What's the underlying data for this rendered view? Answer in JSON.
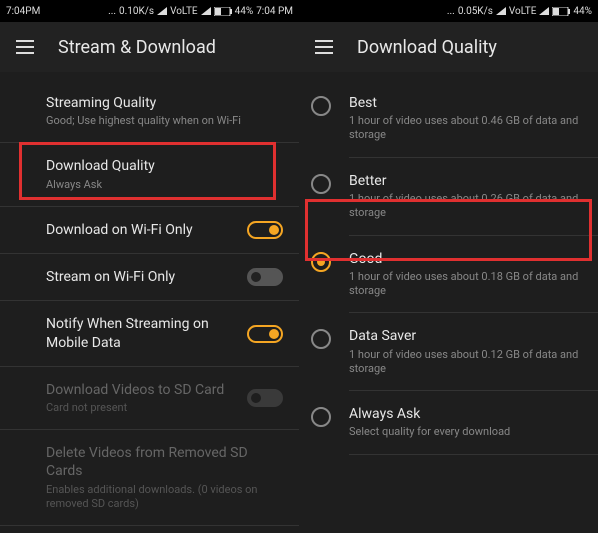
{
  "left": {
    "status": {
      "time_left": "7:04PM",
      "dots": "...",
      "net_speed": "0.10K/s",
      "volte": "VoLTE",
      "battery": "44%",
      "time_right": "7:04 PM"
    },
    "title": "Stream & Download",
    "settings": [
      {
        "title": "Streaming Quality",
        "sub": "Good; Use highest quality when on Wi-Fi"
      },
      {
        "title": "Download Quality",
        "sub": "Always Ask"
      },
      {
        "title": "Download on Wi-Fi Only",
        "sub": ""
      },
      {
        "title": "Stream on Wi-Fi Only",
        "sub": ""
      },
      {
        "title": "Notify When Streaming on Mobile Data",
        "sub": ""
      },
      {
        "title": "Download Videos to SD Card",
        "sub": "Card not present"
      },
      {
        "title": "Delete Videos from Removed SD Cards",
        "sub": "Enables additional downloads. (0 videos on removed SD cards)"
      }
    ]
  },
  "right": {
    "status": {
      "time_left": "",
      "dots": "...",
      "net_speed": "0.05K/s",
      "volte": "VoLTE",
      "battery": "44%",
      "time_right": ""
    },
    "title": "Download Quality",
    "options": [
      {
        "title": "Best",
        "sub": "1 hour of video uses about 0.46 GB of data and storage"
      },
      {
        "title": "Better",
        "sub": "1 hour of video uses about 0.26 GB of data and storage"
      },
      {
        "title": "Good",
        "sub": "1 hour of video uses about 0.18 GB of data and storage"
      },
      {
        "title": "Data Saver",
        "sub": "1 hour of video uses about 0.12 GB of data and storage"
      },
      {
        "title": "Always Ask",
        "sub": "Select quality for every download"
      }
    ]
  }
}
